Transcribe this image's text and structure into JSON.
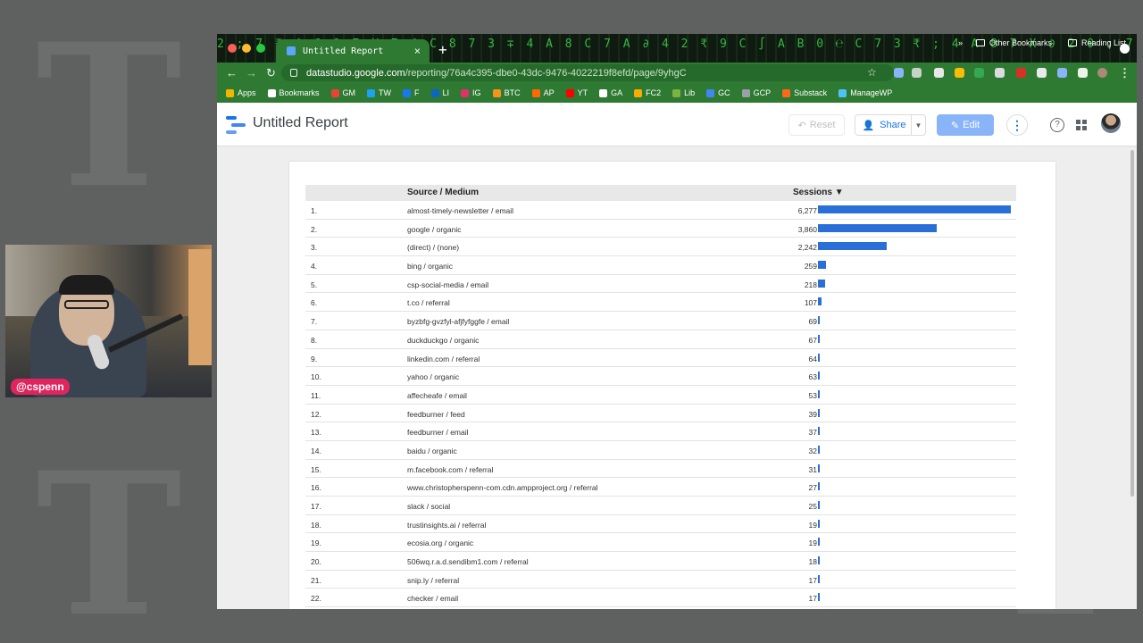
{
  "webcam": {
    "handle": "@cspenn"
  },
  "browser": {
    "tab_title": "Untitled Report",
    "tab_close": "×",
    "new_tab": "+",
    "url_host": "datastudio.google.com",
    "url_path": "/reporting/76a4c395-dbe0-43dc-9476-4022219f8efd/page/9yhgC",
    "matrix_text": "2 ; 7 ₹ 4 C 8 7 X 7 4 C 8 7 3 ∓ 4 A 8 C 7 A ∂ 4 2 ₹ 9 C ∫ A B 0 ℮ C 7 3 ₹ ; 4 A 8 7 X ∂ 2 9 ; 7 ₹ 4 C 8 7 3 ∓ 4 A 8 C 7 A",
    "bookmarks": [
      {
        "label": "Apps",
        "color": "#f4b400"
      },
      {
        "label": "Bookmarks",
        "color": "#ffffff"
      },
      {
        "label": "GM",
        "color": "#ea4335"
      },
      {
        "label": "TW",
        "color": "#1da1f2"
      },
      {
        "label": "F",
        "color": "#1877f2"
      },
      {
        "label": "LI",
        "color": "#0a66c2"
      },
      {
        "label": "IG",
        "color": "#e1306c"
      },
      {
        "label": "BTC",
        "color": "#f7931a"
      },
      {
        "label": "AP",
        "color": "#ff6a00"
      },
      {
        "label": "YT",
        "color": "#ff0000"
      },
      {
        "label": "GA",
        "color": "#ffffff"
      },
      {
        "label": "FC2",
        "color": "#f9ab00"
      },
      {
        "label": "Lib",
        "color": "#7cb342"
      },
      {
        "label": "GC",
        "color": "#4285f4"
      },
      {
        "label": "GCP",
        "color": "#9aa0a6"
      },
      {
        "label": "Substack",
        "color": "#ff6719"
      },
      {
        "label": "ManageWP",
        "color": "#4fc3f7"
      }
    ],
    "bookmarks_more": "»",
    "other_bookmarks": "Other Bookmarks",
    "reading_list": "Reading List"
  },
  "report": {
    "title": "Untitled Report",
    "reset_label": "Reset",
    "share_label": "Share",
    "edit_label": "Edit"
  },
  "table": {
    "header_source": "Source / Medium",
    "header_sessions": "Sessions ▼",
    "max": 6277,
    "rows": [
      {
        "idx": "1.",
        "source": "almost-timely-newsletter / email",
        "sessions": 6277,
        "sessions_label": "6,277"
      },
      {
        "idx": "2.",
        "source": "google / organic",
        "sessions": 3860,
        "sessions_label": "3,860"
      },
      {
        "idx": "3.",
        "source": "(direct) / (none)",
        "sessions": 2242,
        "sessions_label": "2,242"
      },
      {
        "idx": "4.",
        "source": "bing / organic",
        "sessions": 259,
        "sessions_label": "259"
      },
      {
        "idx": "5.",
        "source": "csp-social-media / email",
        "sessions": 218,
        "sessions_label": "218"
      },
      {
        "idx": "6.",
        "source": "t.co / referral",
        "sessions": 107,
        "sessions_label": "107"
      },
      {
        "idx": "7.",
        "source": "byzbfg-gvzfyl-afjfyfggfe / email",
        "sessions": 69,
        "sessions_label": "69"
      },
      {
        "idx": "8.",
        "source": "duckduckgo / organic",
        "sessions": 67,
        "sessions_label": "67"
      },
      {
        "idx": "9.",
        "source": "linkedin.com / referral",
        "sessions": 64,
        "sessions_label": "64"
      },
      {
        "idx": "10.",
        "source": "yahoo / organic",
        "sessions": 63,
        "sessions_label": "63"
      },
      {
        "idx": "11.",
        "source": "affecheafe / email",
        "sessions": 53,
        "sessions_label": "53"
      },
      {
        "idx": "12.",
        "source": "feedburner / feed",
        "sessions": 39,
        "sessions_label": "39"
      },
      {
        "idx": "13.",
        "source": "feedburner / email",
        "sessions": 37,
        "sessions_label": "37"
      },
      {
        "idx": "14.",
        "source": "baidu / organic",
        "sessions": 32,
        "sessions_label": "32"
      },
      {
        "idx": "15.",
        "source": "m.facebook.com / referral",
        "sessions": 31,
        "sessions_label": "31"
      },
      {
        "idx": "16.",
        "source": "www.christopherspenn-com.cdn.ampproject.org / referral",
        "sessions": 27,
        "sessions_label": "27"
      },
      {
        "idx": "17.",
        "source": "slack / social",
        "sessions": 25,
        "sessions_label": "25"
      },
      {
        "idx": "18.",
        "source": "trustinsights.ai / referral",
        "sessions": 19,
        "sessions_label": "19"
      },
      {
        "idx": "19.",
        "source": "ecosia.org / organic",
        "sessions": 19,
        "sessions_label": "19"
      },
      {
        "idx": "20.",
        "source": "506wq.r.a.d.sendibm1.com / referral",
        "sessions": 18,
        "sessions_label": "18"
      },
      {
        "idx": "21.",
        "source": "snip.ly / referral",
        "sessions": 17,
        "sessions_label": "17"
      },
      {
        "idx": "22.",
        "source": "checker / email",
        "sessions": 17,
        "sessions_label": "17"
      }
    ]
  },
  "colors": {
    "bar": "#2a6fd8",
    "chrome_green": "#2f7a33",
    "accent": "#1a73e8"
  }
}
